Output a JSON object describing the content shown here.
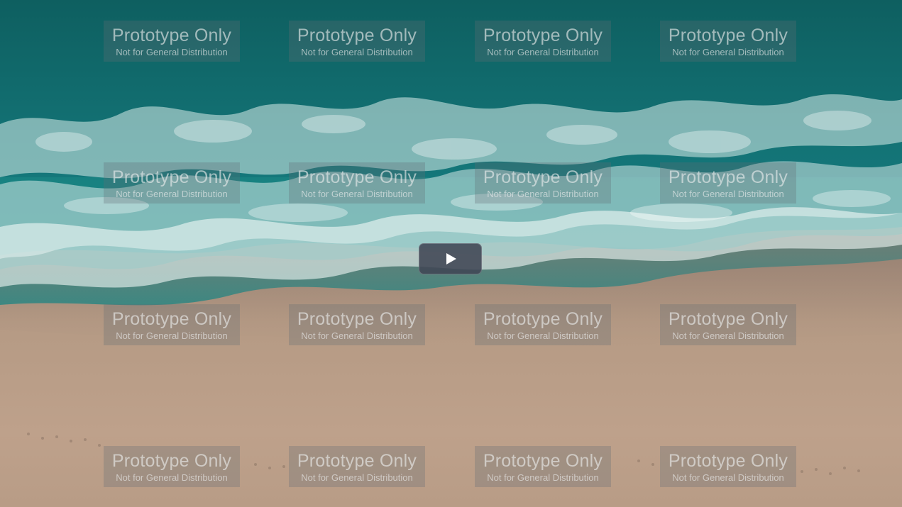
{
  "video": {
    "poster_description_icon": "beach-aerial-poster",
    "play_icon": "play-icon"
  },
  "watermark": {
    "title": "Prototype Only",
    "subtitle": "Not for General Distribution"
  },
  "colors": {
    "sea_deep": "#0f6b6a",
    "sea_light": "#1f8e8a",
    "foam": "#e6f2f0",
    "sand": "#b79a82",
    "sand_light": "#c4a995",
    "play_button_bg": "#404654"
  }
}
